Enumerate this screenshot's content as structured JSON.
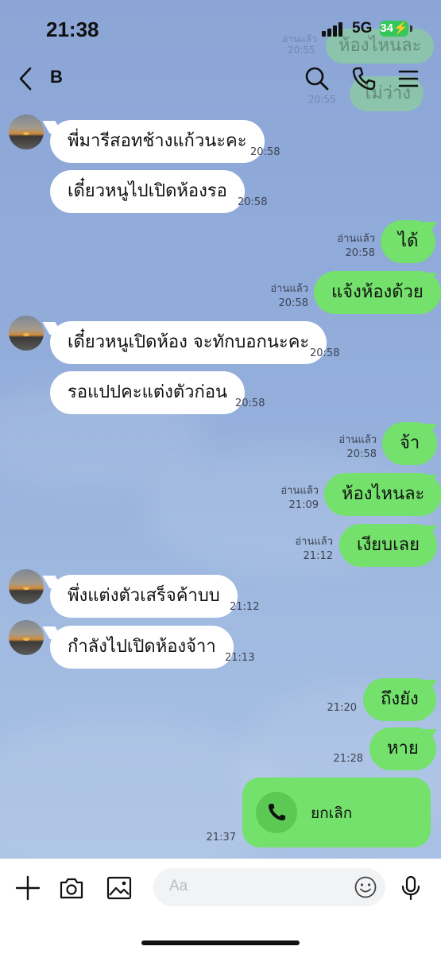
{
  "status_bar": {
    "time": "21:38",
    "network": "5G",
    "battery": "34"
  },
  "header": {
    "title": "B"
  },
  "ghost": {
    "read": "อ่านแล้ว",
    "time1": "20:55",
    "time2": "20:55",
    "msg1": "ห้องไหนละ",
    "msg2": "ไม่ว่าง"
  },
  "messages": [
    {
      "text": "พี่มารีสอทช้างแก้วนะคะ",
      "time": "20:58"
    },
    {
      "text": "เดี๋ยวหนูไปเปิดห้องรอ",
      "time": "20:58"
    },
    {
      "text": "ได้",
      "read": "อ่านแล้ว",
      "time": "20:58"
    },
    {
      "text": "แจ้งห้องด้วย",
      "read": "อ่านแล้ว",
      "time": "20:58"
    },
    {
      "text": "เดี๋ยวหนูเปิดห้อง จะทักบอกนะคะ",
      "time": "20:58"
    },
    {
      "text": "รอแปปคะแต่งตัวก่อน",
      "time": "20:58"
    },
    {
      "text": "จ้า",
      "read": "อ่านแล้ว",
      "time": "20:58"
    },
    {
      "text": "ห้องไหนละ",
      "read": "อ่านแล้ว",
      "time": "21:09"
    },
    {
      "text": "เงียบเลย",
      "read": "อ่านแล้ว",
      "time": "21:12"
    },
    {
      "text": "พึ่งแต่งตัวเสร็จค้าบบ",
      "time": "21:12"
    },
    {
      "text": "กำลังไปเปิดห้องจ้าา",
      "time": "21:13"
    },
    {
      "text": "ถึงยัง",
      "time": "21:20"
    },
    {
      "text": "หาย",
      "time": "21:28"
    }
  ],
  "call": {
    "label": "ยกเลิก",
    "time": "21:37"
  },
  "input": {
    "placeholder": "Aa"
  },
  "colors": {
    "out_bubble": "#73e16b",
    "in_bubble": "#ffffff",
    "background": "#8fa9d8"
  }
}
